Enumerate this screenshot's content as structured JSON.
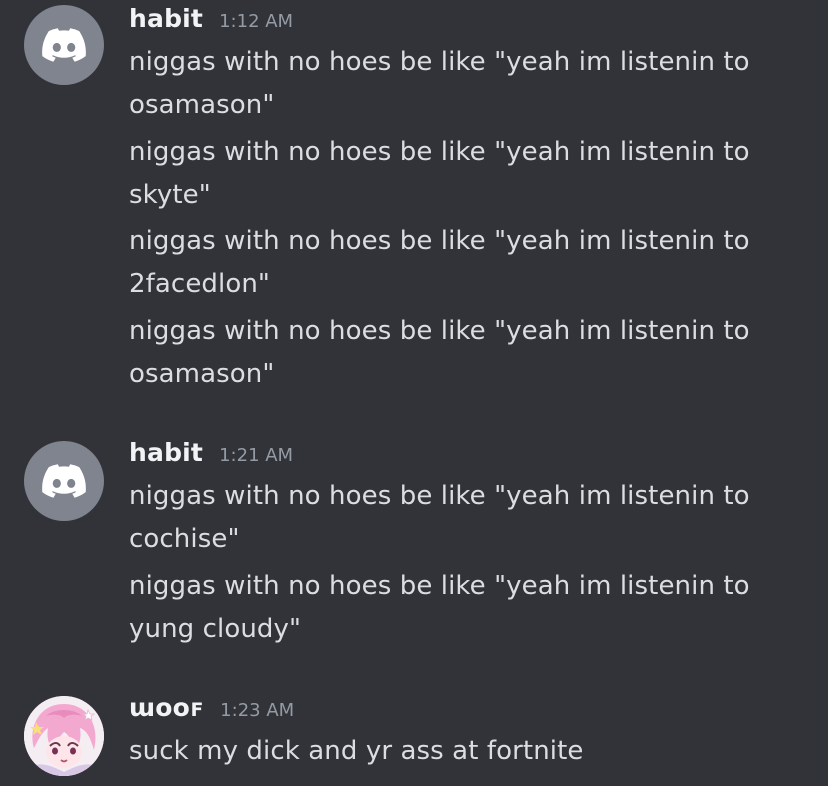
{
  "groups": [
    {
      "username": "habit",
      "timestamp": "1:12 AM",
      "avatar_icon": "discord-logo-icon",
      "messages": [
        "niggas with no hoes be like \"yeah im listenin to osamason\"",
        "niggas with no hoes be like \"yeah im listenin to skyte\"",
        "niggas with no hoes be like \"yeah im listenin to 2facedlon\"",
        "niggas with no hoes be like \"yeah im listenin to osamason\""
      ]
    },
    {
      "username": "habit",
      "timestamp": "1:21 AM",
      "avatar_icon": "discord-logo-icon",
      "messages": [
        "niggas with no hoes be like \"yeah im listenin to cochise\"",
        "niggas with no hoes be like \"yeah im listenin to yung cloudy\""
      ]
    },
    {
      "username": "ɯᴏᴏꜰ",
      "timestamp": "1:23 AM",
      "avatar_icon": "anime-character-avatar",
      "messages": [
        "suck my dick and yr ass at fortnite"
      ]
    }
  ],
  "colors": {
    "background": "#313338",
    "username": "#f2f3f5",
    "timestamp": "#949ba4",
    "message_text": "#dbdee1",
    "default_avatar": "#80848e"
  }
}
